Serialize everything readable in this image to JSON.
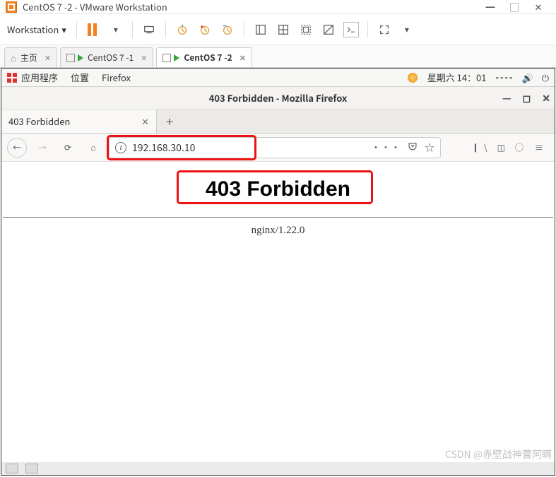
{
  "vmware": {
    "title": "CentOS 7 -2 - VMware Workstation",
    "menu_label": "Workstation",
    "tabs": [
      {
        "label": "主页",
        "kind": "home"
      },
      {
        "label": "CentOS 7 -1",
        "kind": "vm"
      },
      {
        "label": "CentOS 7 -2",
        "kind": "vm",
        "active": true
      }
    ]
  },
  "panel": {
    "apps": "应用程序",
    "places": "位置",
    "firefox": "Firefox",
    "day": "星期六",
    "time": "14：01"
  },
  "firefox": {
    "window_title": "403 Forbidden - Mozilla Firefox",
    "tab_title": "403 Forbidden",
    "url": "192.168.30.10",
    "page": {
      "heading": "403 Forbidden",
      "server": "nginx/1.22.0"
    }
  },
  "watermark": "CSDN @赤壁战神曹阿瞒"
}
